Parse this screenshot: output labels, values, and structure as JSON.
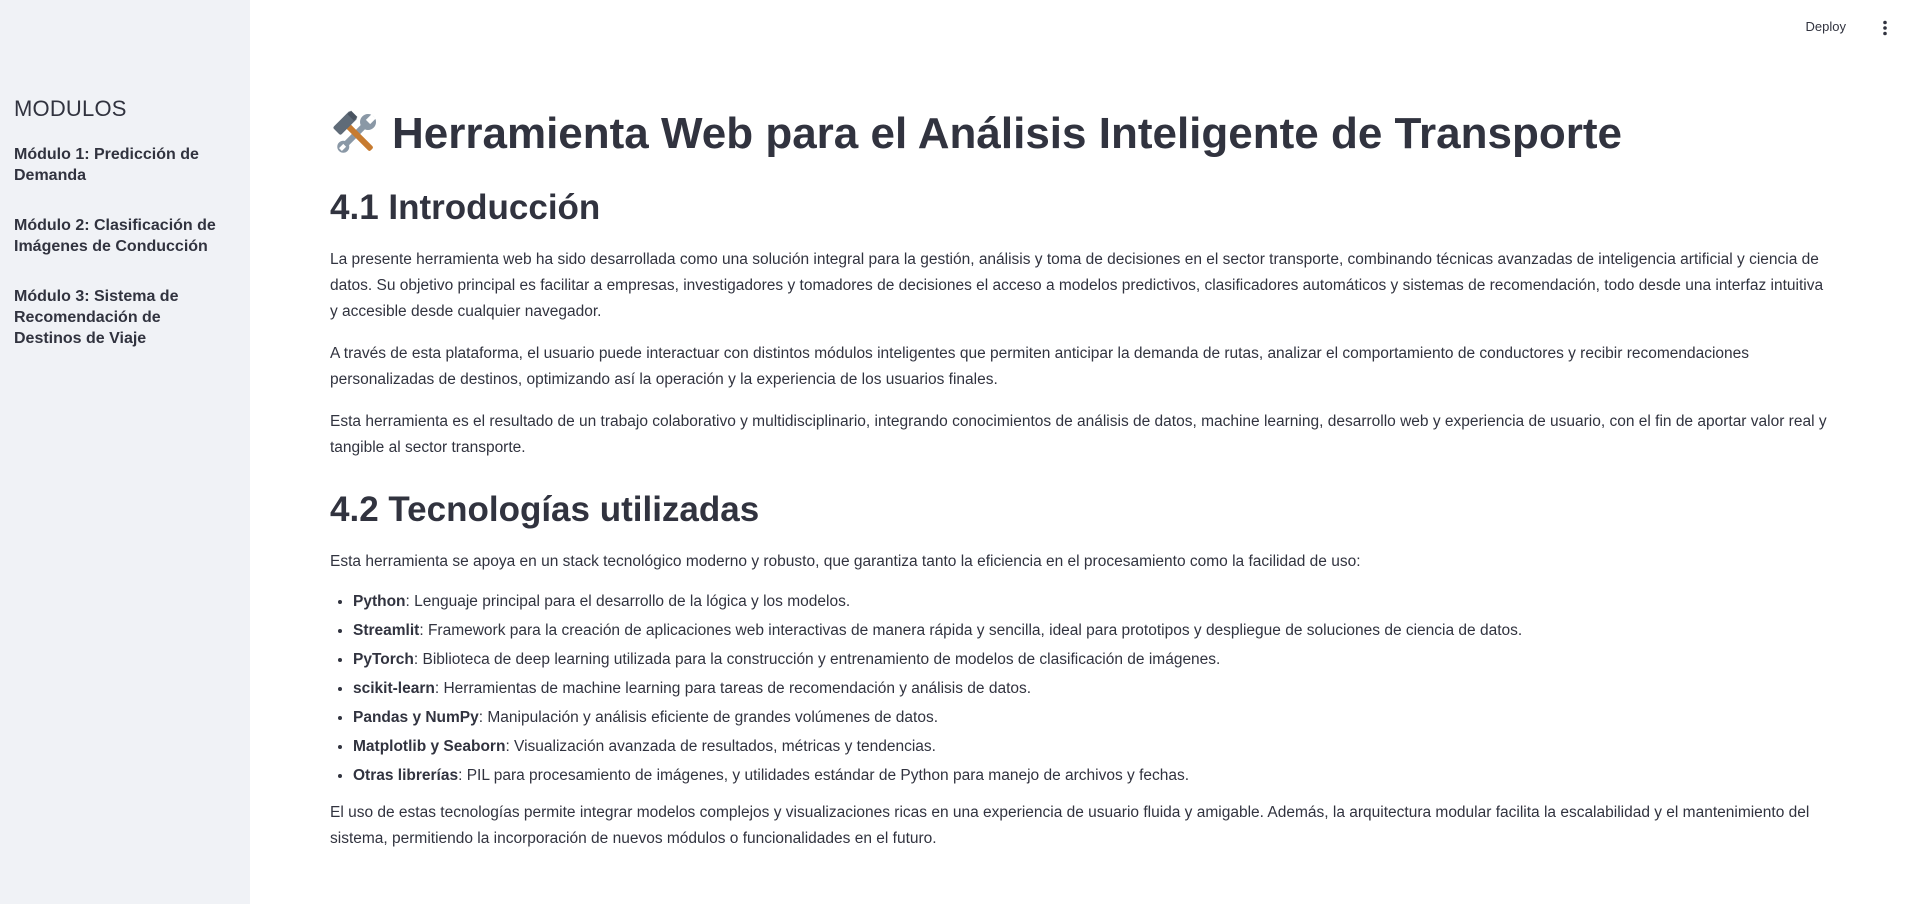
{
  "sidebar": {
    "heading": "MODULOS",
    "items": [
      {
        "label": "Módulo 1: Predicción de Demanda"
      },
      {
        "label": "Módulo 2: Clasificación de Imágenes de Conducción"
      },
      {
        "label": "Módulo 3: Sistema de Recomendación de Destinos de Viaje"
      }
    ]
  },
  "header": {
    "deploy_label": "Deploy",
    "menu_icon": "vertical-ellipsis-icon"
  },
  "main": {
    "title_icon": "hammer-and-wrench-icon",
    "title": "Herramienta Web para el Análisis Inteligente de Transporte",
    "sections": [
      {
        "heading": "4.1 Introducción",
        "paragraphs": [
          "La presente herramienta web ha sido desarrollada como una solución integral para la gestión, análisis y toma de decisiones en el sector transporte, combinando técnicas avanzadas de inteligencia artificial y ciencia de datos. Su objetivo principal es facilitar a empresas, investigadores y tomadores de decisiones el acceso a modelos predictivos, clasificadores automáticos y sistemas de recomendación, todo desde una interfaz intuitiva y accesible desde cualquier navegador.",
          "A través de esta plataforma, el usuario puede interactuar con distintos módulos inteligentes que permiten anticipar la demanda de rutas, analizar el comportamiento de conductores y recibir recomendaciones personalizadas de destinos, optimizando así la operación y la experiencia de los usuarios finales.",
          "Esta herramienta es el resultado de un trabajo colaborativo y multidisciplinario, integrando conocimientos de análisis de datos, machine learning, desarrollo web y experiencia de usuario, con el fin de aportar valor real y tangible al sector transporte."
        ]
      },
      {
        "heading": "4.2 Tecnologías utilizadas",
        "intro": "Esta herramienta se apoya en un stack tecnológico moderno y robusto, que garantiza tanto la eficiencia en el procesamiento como la facilidad de uso:",
        "items": [
          {
            "term": "Python",
            "desc": ": Lenguaje principal para el desarrollo de la lógica y los modelos."
          },
          {
            "term": "Streamlit",
            "desc": ": Framework para la creación de aplicaciones web interactivas de manera rápida y sencilla, ideal para prototipos y despliegue de soluciones de ciencia de datos."
          },
          {
            "term": "PyTorch",
            "desc": ": Biblioteca de deep learning utilizada para la construcción y entrenamiento de modelos de clasificación de imágenes."
          },
          {
            "term": "scikit-learn",
            "desc": ": Herramientas de machine learning para tareas de recomendación y análisis de datos."
          },
          {
            "term": "Pandas y NumPy",
            "desc": ": Manipulación y análisis eficiente de grandes volúmenes de datos."
          },
          {
            "term": "Matplotlib y Seaborn",
            "desc": ": Visualización avanzada de resultados, métricas y tendencias."
          },
          {
            "term": "Otras librerías",
            "desc": ": PIL para procesamiento de imágenes, y utilidades estándar de Python para manejo de archivos y fechas."
          }
        ],
        "outro": "El uso de estas tecnologías permite integrar modelos complejos y visualizaciones ricas en una experiencia de usuario fluida y amigable. Además, la arquitectura modular facilita la escalabilidad y el mantenimiento del sistema, permitiendo la incorporación de nuevos módulos o funcionalidades en el futuro."
      }
    ]
  },
  "colors": {
    "sidebar_bg": "#f0f2f6",
    "text": "#31333f",
    "background": "#ffffff"
  }
}
